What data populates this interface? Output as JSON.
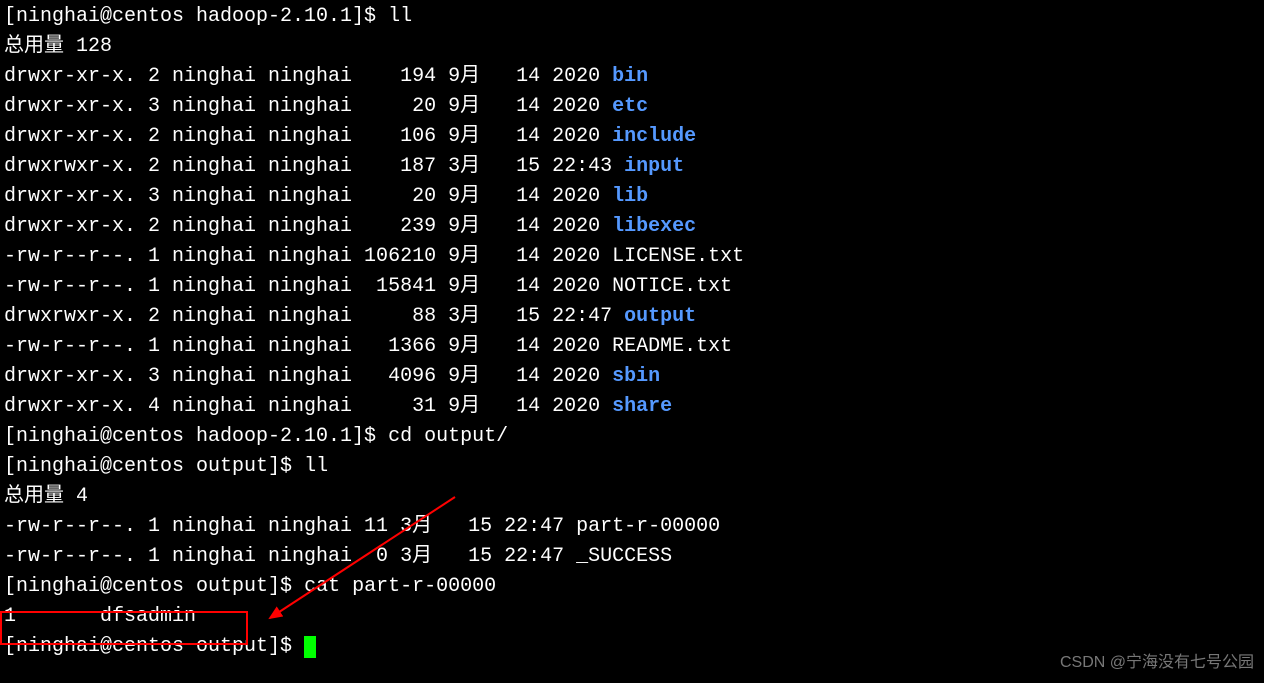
{
  "prompt1": {
    "prefix": "[ninghai@centos hadoop-2.10.1]$ ",
    "cmd": "ll"
  },
  "total1": "总用量 128",
  "listing1": [
    {
      "perm": "drwxr-xr-x.",
      "n": " 2",
      "user": "ninghai",
      "group": "ninghai",
      "size": "   194",
      "m": "9月 ",
      "d": " 14",
      "t": "2020",
      "name": "bin",
      "dir": true
    },
    {
      "perm": "drwxr-xr-x.",
      "n": " 3",
      "user": "ninghai",
      "group": "ninghai",
      "size": "    20",
      "m": "9月 ",
      "d": " 14",
      "t": "2020",
      "name": "etc",
      "dir": true
    },
    {
      "perm": "drwxr-xr-x.",
      "n": " 2",
      "user": "ninghai",
      "group": "ninghai",
      "size": "   106",
      "m": "9月 ",
      "d": " 14",
      "t": "2020",
      "name": "include",
      "dir": true
    },
    {
      "perm": "drwxrwxr-x.",
      "n": " 2",
      "user": "ninghai",
      "group": "ninghai",
      "size": "   187",
      "m": "3月 ",
      "d": " 15",
      "t": "22:43",
      "name": "input",
      "dir": true
    },
    {
      "perm": "drwxr-xr-x.",
      "n": " 3",
      "user": "ninghai",
      "group": "ninghai",
      "size": "    20",
      "m": "9月 ",
      "d": " 14",
      "t": "2020",
      "name": "lib",
      "dir": true
    },
    {
      "perm": "drwxr-xr-x.",
      "n": " 2",
      "user": "ninghai",
      "group": "ninghai",
      "size": "   239",
      "m": "9月 ",
      "d": " 14",
      "t": "2020",
      "name": "libexec",
      "dir": true
    },
    {
      "perm": "-rw-r--r--.",
      "n": " 1",
      "user": "ninghai",
      "group": "ninghai",
      "size": "106210",
      "m": "9月 ",
      "d": " 14",
      "t": "2020",
      "name": "LICENSE.txt",
      "dir": false
    },
    {
      "perm": "-rw-r--r--.",
      "n": " 1",
      "user": "ninghai",
      "group": "ninghai",
      "size": " 15841",
      "m": "9月 ",
      "d": " 14",
      "t": "2020",
      "name": "NOTICE.txt",
      "dir": false
    },
    {
      "perm": "drwxrwxr-x.",
      "n": " 2",
      "user": "ninghai",
      "group": "ninghai",
      "size": "    88",
      "m": "3月 ",
      "d": " 15",
      "t": "22:47",
      "name": "output",
      "dir": true
    },
    {
      "perm": "-rw-r--r--.",
      "n": " 1",
      "user": "ninghai",
      "group": "ninghai",
      "size": "  1366",
      "m": "9月 ",
      "d": " 14",
      "t": "2020",
      "name": "README.txt",
      "dir": false
    },
    {
      "perm": "drwxr-xr-x.",
      "n": " 3",
      "user": "ninghai",
      "group": "ninghai",
      "size": "  4096",
      "m": "9月 ",
      "d": " 14",
      "t": "2020",
      "name": "sbin",
      "dir": true
    },
    {
      "perm": "drwxr-xr-x.",
      "n": " 4",
      "user": "ninghai",
      "group": "ninghai",
      "size": "    31",
      "m": "9月 ",
      "d": " 14",
      "t": "2020",
      "name": "share",
      "dir": true
    }
  ],
  "prompt2": {
    "prefix": "[ninghai@centos hadoop-2.10.1]$ ",
    "cmd": "cd output/"
  },
  "prompt3": {
    "prefix": "[ninghai@centos output]$ ",
    "cmd": "ll"
  },
  "total2": "总用量 4",
  "listing2": [
    {
      "perm": "-rw-r--r--.",
      "n": " 1",
      "user": "ninghai",
      "group": "ninghai",
      "size": "11",
      "m": "3月 ",
      "d": " 15",
      "t": "22:47",
      "name": "part-r-00000",
      "dir": false
    },
    {
      "perm": "-rw-r--r--.",
      "n": " 1",
      "user": "ninghai",
      "group": "ninghai",
      "size": " 0",
      "m": "3月 ",
      "d": " 15",
      "t": "22:47",
      "name": "_SUCCESS",
      "dir": false
    }
  ],
  "prompt4": {
    "prefix": "[ninghai@centos output]$ ",
    "cmd": "cat part-r-00000"
  },
  "cat_output": "1       dfsadmin",
  "prompt5": {
    "prefix": "[ninghai@centos output]$ ",
    "cmd": ""
  },
  "watermark": "CSDN @宁海没有七号公园"
}
